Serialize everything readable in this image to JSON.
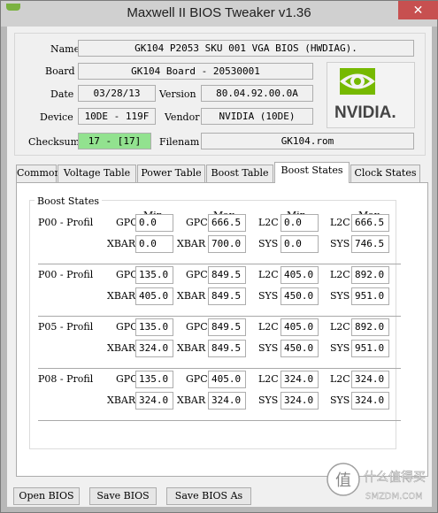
{
  "window": {
    "title": "Maxwell II BIOS Tweaker v1.36",
    "close_glyph": "✕"
  },
  "info": {
    "name_label": "Name",
    "name_value": "GK104 P2053 SKU 001 VGA BIOS (HWDIAG).",
    "board_label": "Board",
    "board_value": "GK104 Board - 20530001",
    "date_label": "Date",
    "date_value": "03/28/13",
    "version_label": "Version",
    "version_value": "80.04.92.00.0A",
    "device_label": "Device",
    "device_value": "10DE - 119F",
    "vendor_label": "Vendor",
    "vendor_value": "NVIDIA (10DE)",
    "checksum_label": "Checksum",
    "checksum_value": "17 - [17]",
    "filename_label": "Filenam",
    "filename_value": "GK104.rom",
    "checksum_color": "#92e28f"
  },
  "logo": {
    "text": "NVIDIA.",
    "color": "#76b900"
  },
  "tabs": [
    {
      "label": "Common"
    },
    {
      "label": "Voltage Table"
    },
    {
      "label": "Power Table"
    },
    {
      "label": "Boost Table"
    },
    {
      "label": "Boost States"
    },
    {
      "label": "Clock States"
    }
  ],
  "boost": {
    "group_title": "Boost States",
    "headers": [
      "Min",
      "Max",
      "Min",
      "Max"
    ],
    "rows": [
      {
        "profile": "P00 - Profil",
        "gpc_min": "0.0",
        "gpc_max": "666.5",
        "l2c_min": "0.0",
        "l2c_max": "666.5",
        "xbar_min": "0.0",
        "xbar_max": "700.0",
        "sys_min": "0.0",
        "sys_max": "746.5"
      },
      {
        "profile": "P00 - Profil",
        "gpc_min": "135.0",
        "gpc_max": "849.5",
        "l2c_min": "405.0",
        "l2c_max": "892.0",
        "xbar_min": "405.0",
        "xbar_max": "849.5",
        "sys_min": "450.0",
        "sys_max": "951.0"
      },
      {
        "profile": "P05 - Profil",
        "gpc_min": "135.0",
        "gpc_max": "849.5",
        "l2c_min": "405.0",
        "l2c_max": "892.0",
        "xbar_min": "324.0",
        "xbar_max": "849.5",
        "sys_min": "450.0",
        "sys_max": "951.0"
      },
      {
        "profile": "P08 - Profil",
        "gpc_min": "135.0",
        "gpc_max": "405.0",
        "l2c_min": "324.0",
        "l2c_max": "324.0",
        "xbar_min": "324.0",
        "xbar_max": "324.0",
        "sys_min": "324.0",
        "sys_max": "324.0"
      }
    ],
    "labels": {
      "gpc": "GPC",
      "xbar": "XBAR",
      "l2c": "L2C",
      "sys": "SYS"
    }
  },
  "buttons": {
    "open": "Open BIOS",
    "save": "Save BIOS",
    "save_as": "Save BIOS As"
  },
  "watermark": {
    "line1": "什么值得买",
    "line2": "SMZDM.COM"
  }
}
